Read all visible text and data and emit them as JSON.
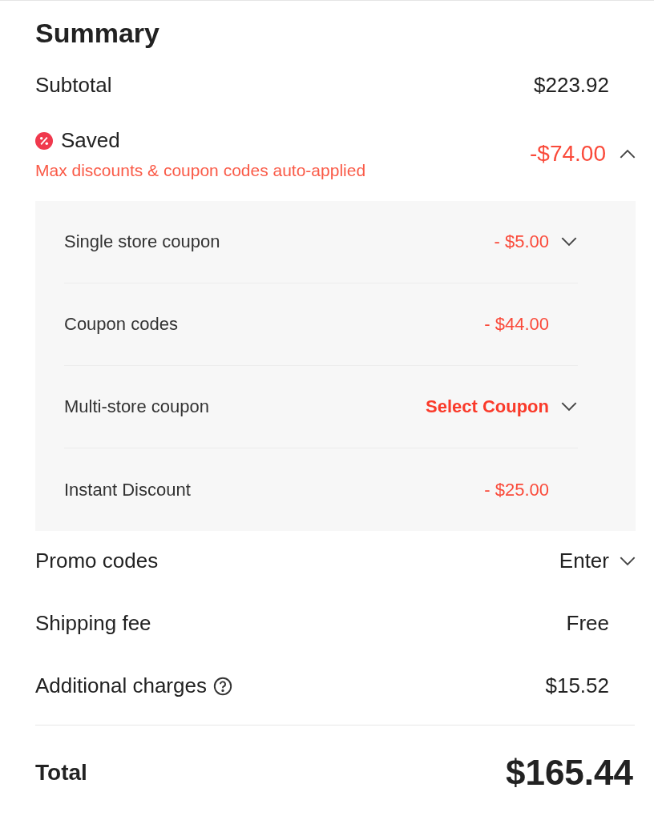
{
  "title": "Summary",
  "subtotal": {
    "label": "Subtotal",
    "value": "$223.92"
  },
  "saved": {
    "label": "Saved",
    "note": "Max discounts & coupon codes auto-applied",
    "value": "-$74.00",
    "expanded": true,
    "items": [
      {
        "kind": "amount",
        "label": "Single store coupon",
        "value": "- $5.00",
        "dropdown": true
      },
      {
        "kind": "amount",
        "label": "Coupon codes",
        "value": "- $44.00",
        "dropdown": false
      },
      {
        "kind": "link",
        "label": "Multi-store coupon",
        "value": "Select Coupon",
        "dropdown": true
      },
      {
        "kind": "amount",
        "label": "Instant Discount",
        "value": "- $25.00",
        "dropdown": false
      }
    ]
  },
  "rows": [
    {
      "kind": "dropdown",
      "label": "Promo codes",
      "value": "Enter"
    },
    {
      "kind": "plain",
      "label": "Shipping fee",
      "value": "Free"
    },
    {
      "kind": "help",
      "label": "Additional charges",
      "value": "$15.52"
    }
  ],
  "total": {
    "label": "Total",
    "value": "$165.44"
  }
}
